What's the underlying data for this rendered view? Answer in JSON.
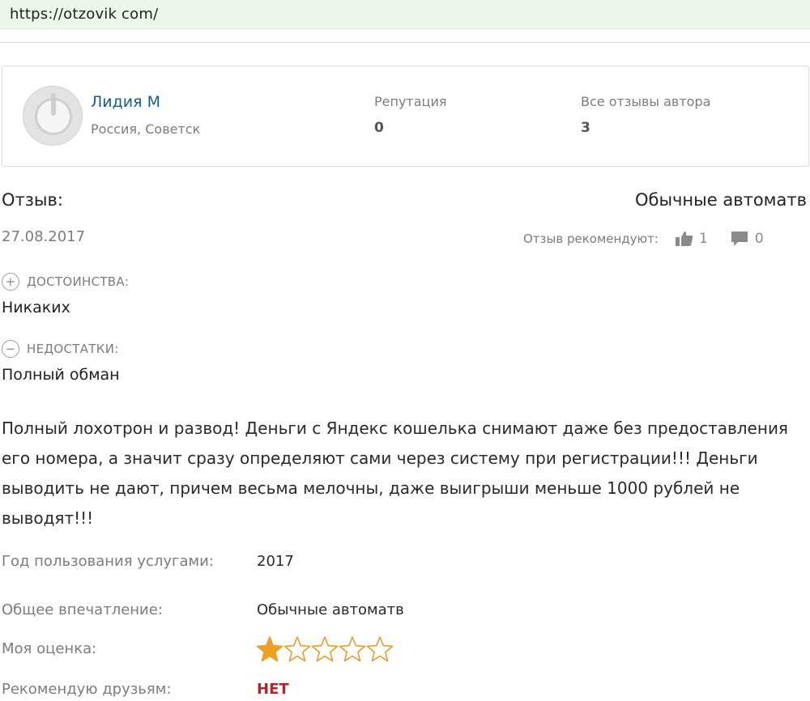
{
  "browser": {
    "url": "https://otzovik com/"
  },
  "author": {
    "name": "Лидия М",
    "location": "Россия, Советск",
    "reputation_label": "Репутация",
    "reputation_value": "0",
    "reviews_label": "Все отзывы автора",
    "reviews_value": "3"
  },
  "review": {
    "label": "Отзыв:",
    "title": "Обычные автоматв",
    "date": "27.08.2017",
    "recommend_label": "Отзыв рекомендуют:",
    "likes": "1",
    "comments": "0",
    "pros_label": "ДОСТОИНСТВА:",
    "pros_text": "Никаких",
    "cons_label": "НЕДОСТАТКИ:",
    "cons_text": "Полный обман",
    "body": "Полный лохотрон и развод! Деньги с Яндекс кошелька снимают даже без предоставления его номера, а значит сразу определяют сами через систему при регистрации!!! Деньги выводить не дают, причем весьма мелочны, даже выигрыши меньше 1000 рублей не выводят!!!"
  },
  "meta": {
    "year_label": "Год пользования услугами:",
    "year_value": "2017",
    "impression_label": "Общее впечатление:",
    "impression_value": "Обычные автоматв",
    "rating_label": "Моя оценка:",
    "rating_value": 1,
    "rating_max": 5,
    "recommend_label": "Рекомендую друзьям:",
    "recommend_value": "НЕТ"
  },
  "colors": {
    "author_name": "#155f86",
    "star_filled": "#f0a020",
    "star_empty_stroke": "#e0a030",
    "no_value": "#b52424",
    "urlbar": "#edf6ea"
  },
  "icons": {
    "pros": "plus-circle-icon",
    "cons": "minus-circle-icon",
    "likes": "thumbs-up-icon",
    "comments": "comment-icon",
    "avatar": "default-avatar-icon"
  }
}
